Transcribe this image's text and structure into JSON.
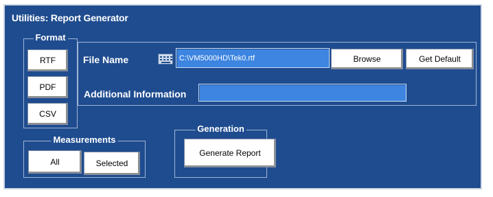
{
  "panel": {
    "title": "Utilities: Report Generator"
  },
  "format": {
    "label": "Format",
    "rtf": "RTF",
    "pdf": "PDF",
    "csv": "CSV"
  },
  "file": {
    "label": "File Name",
    "value": "C:\\VM5000HD\\Tek0.rtf",
    "browse": "Browse",
    "get_default": "Get Default"
  },
  "additional": {
    "label": "Additional Information",
    "value": ""
  },
  "measurements": {
    "label": "Measurements",
    "all": "All",
    "selected": "Selected"
  },
  "generation": {
    "label": "Generation",
    "button": "Generate Report"
  },
  "colors": {
    "panel_bg": "#1f4c8f",
    "field_bg": "#3d85e0",
    "button_bg": "#ffffff"
  }
}
